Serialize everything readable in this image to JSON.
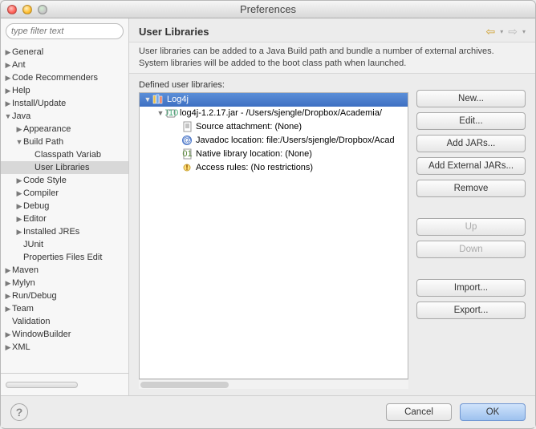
{
  "window": {
    "title": "Preferences"
  },
  "sidebar": {
    "filter_placeholder": "type filter text",
    "items": [
      {
        "label": "General",
        "level": 0,
        "arrow": "right"
      },
      {
        "label": "Ant",
        "level": 0,
        "arrow": "right"
      },
      {
        "label": "Code Recommenders",
        "level": 0,
        "arrow": "right"
      },
      {
        "label": "Help",
        "level": 0,
        "arrow": "right"
      },
      {
        "label": "Install/Update",
        "level": 0,
        "arrow": "right"
      },
      {
        "label": "Java",
        "level": 0,
        "arrow": "down"
      },
      {
        "label": "Appearance",
        "level": 1,
        "arrow": "right"
      },
      {
        "label": "Build Path",
        "level": 1,
        "arrow": "down"
      },
      {
        "label": "Classpath Variab",
        "level": 2,
        "arrow": ""
      },
      {
        "label": "User Libraries",
        "level": 2,
        "arrow": "",
        "selected": true
      },
      {
        "label": "Code Style",
        "level": 1,
        "arrow": "right"
      },
      {
        "label": "Compiler",
        "level": 1,
        "arrow": "right"
      },
      {
        "label": "Debug",
        "level": 1,
        "arrow": "right"
      },
      {
        "label": "Editor",
        "level": 1,
        "arrow": "right"
      },
      {
        "label": "Installed JREs",
        "level": 1,
        "arrow": "right"
      },
      {
        "label": "JUnit",
        "level": 1,
        "arrow": ""
      },
      {
        "label": "Properties Files Edit",
        "level": 1,
        "arrow": ""
      },
      {
        "label": "Maven",
        "level": 0,
        "arrow": "right"
      },
      {
        "label": "Mylyn",
        "level": 0,
        "arrow": "right"
      },
      {
        "label": "Run/Debug",
        "level": 0,
        "arrow": "right"
      },
      {
        "label": "Team",
        "level": 0,
        "arrow": "right"
      },
      {
        "label": "Validation",
        "level": 0,
        "arrow": ""
      },
      {
        "label": "WindowBuilder",
        "level": 0,
        "arrow": "right"
      },
      {
        "label": "XML",
        "level": 0,
        "arrow": "right"
      }
    ]
  },
  "page": {
    "title": "User Libraries",
    "description": "User libraries can be added to a Java Build path and bundle a number of external archives. System libraries will be added to the boot class path when launched.",
    "defined_label": "Defined user libraries:",
    "tree": [
      {
        "label": "Log4j",
        "level": 0,
        "arrow": "down",
        "icon": "library",
        "selected": true
      },
      {
        "label": "log4j-1.2.17.jar - /Users/sjengle/Dropbox/Academia/",
        "level": 1,
        "arrow": "down",
        "icon": "jar"
      },
      {
        "label": "Source attachment: (None)",
        "level": 2,
        "arrow": "",
        "icon": "source"
      },
      {
        "label": "Javadoc location: file:/Users/sjengle/Dropbox/Acad",
        "level": 2,
        "arrow": "",
        "icon": "javadoc"
      },
      {
        "label": "Native library location: (None)",
        "level": 2,
        "arrow": "",
        "icon": "native"
      },
      {
        "label": "Access rules: (No restrictions)",
        "level": 2,
        "arrow": "",
        "icon": "access"
      }
    ],
    "buttons": {
      "new": "New...",
      "edit": "Edit...",
      "add_jars": "Add JARs...",
      "add_ext": "Add External JARs...",
      "remove": "Remove",
      "up": "Up",
      "down": "Down",
      "import": "Import...",
      "export": "Export..."
    }
  },
  "footer": {
    "cancel": "Cancel",
    "ok": "OK"
  }
}
